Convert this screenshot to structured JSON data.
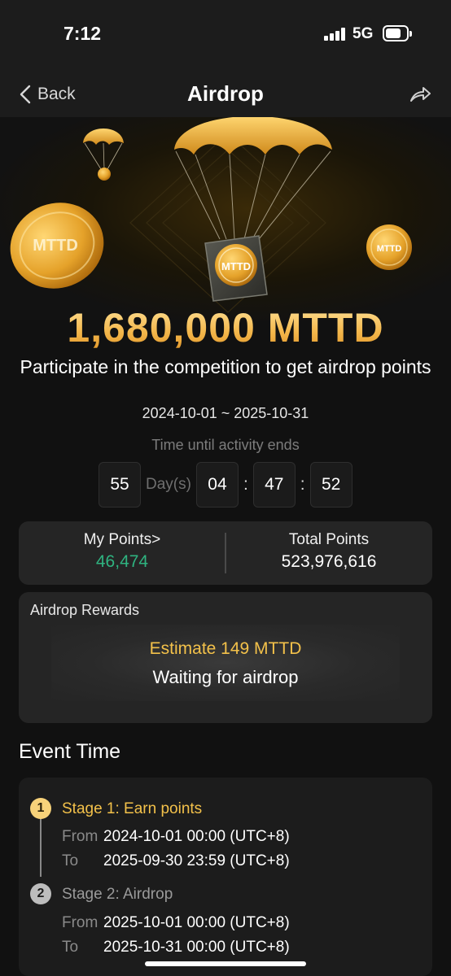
{
  "status_bar": {
    "time": "7:12",
    "network": "5G"
  },
  "nav": {
    "back_label": "Back",
    "title": "Airdrop"
  },
  "hero": {
    "coin_text": "MTTD",
    "amount": "1,680,000 MTTD",
    "subtitle": "Participate in the competition to get airdrop points",
    "date_range": "2024-10-01 ~ 2025-10-31",
    "countdown_label": "Time until activity ends",
    "countdown": {
      "days": "55",
      "days_unit": "Day(s)",
      "hours": "04",
      "minutes": "47",
      "seconds": "52"
    }
  },
  "points": {
    "my_label": "My Points>",
    "my_value": "46,474",
    "total_label": "Total Points",
    "total_value": "523,976,616"
  },
  "rewards": {
    "title": "Airdrop Rewards",
    "estimate": "Estimate 149 MTTD",
    "status": "Waiting for airdrop"
  },
  "event_time": {
    "title": "Event Time",
    "stages": [
      {
        "number": "1",
        "title": "Stage 1: Earn points",
        "from_label": "From",
        "from": "2024-10-01 00:00 (UTC+8)",
        "to_label": "To",
        "to": "2025-09-30 23:59 (UTC+8)"
      },
      {
        "number": "2",
        "title": "Stage 2: Airdrop",
        "from_label": "From",
        "from": "2025-10-01 00:00 (UTC+8)",
        "to_label": "To",
        "to": "2025-10-31 00:00 (UTC+8)"
      }
    ]
  },
  "colors": {
    "background": "#111111",
    "accent_gold": "#f3c14a",
    "positive_green": "#2fb380",
    "card": "#252525"
  },
  "icons": [
    "signal-icon",
    "battery-icon",
    "chevron-left-icon",
    "share-icon",
    "parachute-icon",
    "coin-icon"
  ]
}
